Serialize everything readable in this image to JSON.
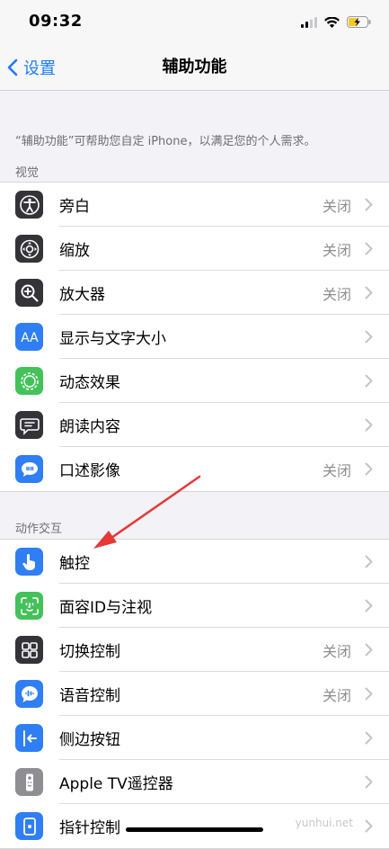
{
  "status": {
    "time": "09:32"
  },
  "nav": {
    "back_label": "设置",
    "title": "辅助功能"
  },
  "description": "“辅助功能”可帮助您自定 iPhone，以满足您的个人需求。",
  "sections": [
    {
      "header": "视觉",
      "rows": [
        {
          "label": "旁白",
          "value": "关闭",
          "icon": "voiceover-icon",
          "color": "#333338"
        },
        {
          "label": "缩放",
          "value": "关闭",
          "icon": "zoom-icon",
          "color": "#333338"
        },
        {
          "label": "放大器",
          "value": "关闭",
          "icon": "magnifier-icon",
          "color": "#333338"
        },
        {
          "label": "显示与文字大小",
          "value": "",
          "icon": "text-size-icon",
          "color": "#2f7ef3"
        },
        {
          "label": "动态效果",
          "value": "",
          "icon": "motion-icon",
          "color": "#43c25a"
        },
        {
          "label": "朗读内容",
          "value": "",
          "icon": "spoken-content-icon",
          "color": "#333338"
        },
        {
          "label": "口述影像",
          "value": "关闭",
          "icon": "audio-description-icon",
          "color": "#2f7ef3"
        }
      ]
    },
    {
      "header": "动作交互",
      "rows": [
        {
          "label": "触控",
          "value": "",
          "icon": "touch-icon",
          "color": "#2f7ef3"
        },
        {
          "label": "面容ID与注视",
          "value": "",
          "icon": "face-id-icon",
          "color": "#43c25a"
        },
        {
          "label": "切换控制",
          "value": "关闭",
          "icon": "switch-control-icon",
          "color": "#333338"
        },
        {
          "label": "语音控制",
          "value": "关闭",
          "icon": "voice-control-icon",
          "color": "#2f7ef3"
        },
        {
          "label": "侧边按钮",
          "value": "",
          "icon": "side-button-icon",
          "color": "#2f7ef3"
        },
        {
          "label": "Apple TV遥控器",
          "value": "",
          "icon": "tv-remote-icon",
          "color": "#8e8e93"
        },
        {
          "label": "指针控制",
          "value": "",
          "icon": "pointer-control-icon",
          "color": "#2f7ef3"
        }
      ]
    }
  ],
  "watermark": "yunhui.net",
  "colors": {
    "accent": "#1b7cf5",
    "annotation_arrow": "#e53935"
  }
}
